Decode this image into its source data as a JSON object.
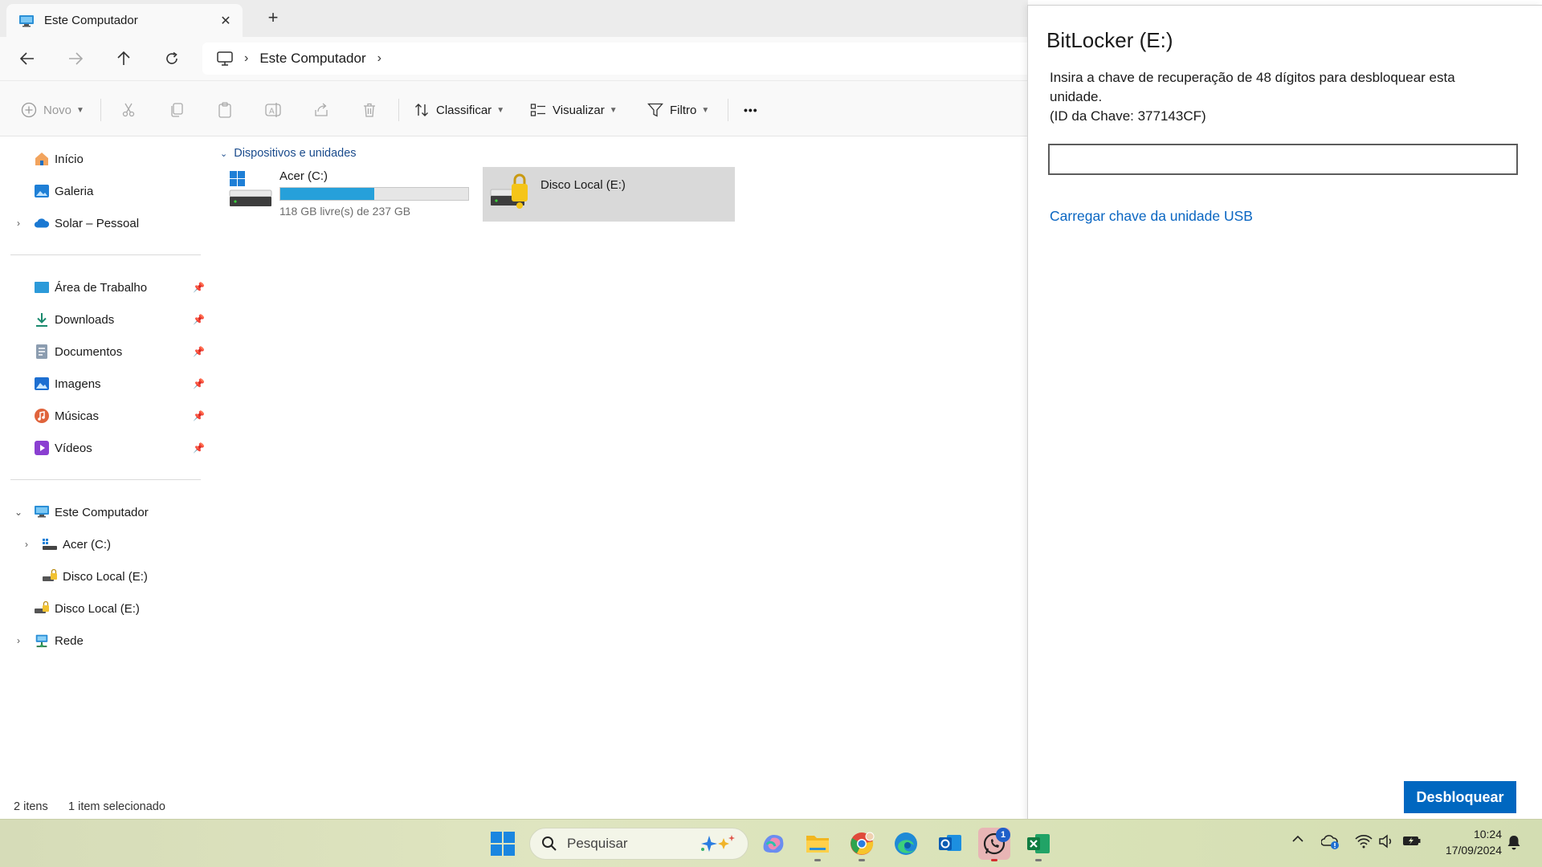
{
  "explorer": {
    "tab_title": "Este Computador",
    "tab_close": "✕",
    "new_tab": "+",
    "breadcrumb": [
      "Este Computador"
    ],
    "toolbar": {
      "novo": "Novo",
      "classificar": "Classificar",
      "visualizar": "Visualizar",
      "filtro": "Filtro",
      "more": "•••"
    },
    "sidebar": {
      "top": [
        {
          "label": "Início",
          "icon": "home-icon"
        },
        {
          "label": "Galeria",
          "icon": "gallery-icon"
        },
        {
          "label": "Solar – Pessoal",
          "icon": "onedrive-icon"
        }
      ],
      "pinned": [
        {
          "label": "Área de Trabalho",
          "icon": "desktop-icon"
        },
        {
          "label": "Downloads",
          "icon": "download-icon"
        },
        {
          "label": "Documentos",
          "icon": "documents-icon"
        },
        {
          "label": "Imagens",
          "icon": "pictures-icon"
        },
        {
          "label": "Músicas",
          "icon": "music-icon"
        },
        {
          "label": "Vídeos",
          "icon": "videos-icon"
        }
      ],
      "tree": [
        {
          "label": "Este Computador",
          "icon": "computer-icon"
        },
        {
          "label": "Acer (C:)",
          "icon": "drive-icon"
        },
        {
          "label": "Disco Local (E:)",
          "icon": "locked-drive-icon"
        },
        {
          "label": "Disco Local (E:)",
          "icon": "locked-drive-icon"
        },
        {
          "label": "Rede",
          "icon": "network-icon"
        }
      ]
    },
    "content": {
      "group_title": "Dispositivos e unidades",
      "drives": [
        {
          "name": "Acer (C:)",
          "free_text": "118 GB livre(s) de 237 GB",
          "used_fraction": 0.502
        },
        {
          "name": "Disco Local (E:)",
          "locked": true
        }
      ]
    },
    "status": {
      "count": "2 itens",
      "selected": "1 item selecionado"
    }
  },
  "bitlocker": {
    "title": "BitLocker (E:)",
    "description_line1": "Insira a chave de recuperação de 48 dígitos para desbloquear esta unidade.",
    "description_line2": "(ID da Chave: 377143CF)",
    "input_value": "",
    "usb_link": "Carregar chave da unidade USB",
    "unlock_button": "Desbloquear"
  },
  "taskbar": {
    "search_placeholder": "Pesquisar",
    "whatsapp_badge": "1",
    "time": "10:24",
    "date": "17/09/2024"
  },
  "colors": {
    "accent": "#0067c0",
    "link": "#0a66c2",
    "drive_bar": "#26a0da",
    "selection": "#d9d9d9"
  }
}
